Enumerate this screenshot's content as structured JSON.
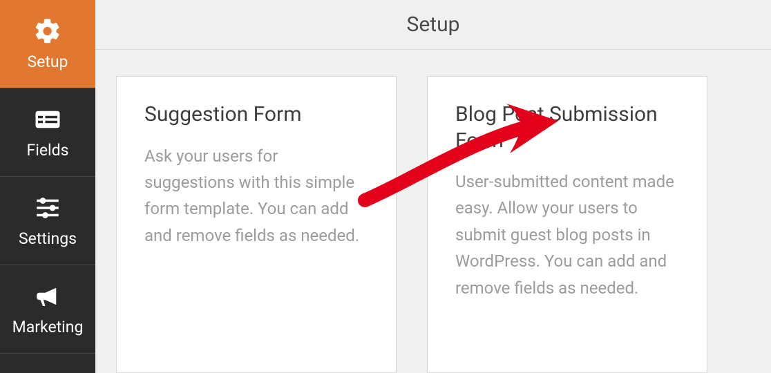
{
  "header": {
    "title": "Setup"
  },
  "sidebar": {
    "items": [
      {
        "label": "Setup",
        "icon": "gear-icon",
        "active": true
      },
      {
        "label": "Fields",
        "icon": "list-icon",
        "active": false
      },
      {
        "label": "Settings",
        "icon": "sliders-icon",
        "active": false
      },
      {
        "label": "Marketing",
        "icon": "megaphone-icon",
        "active": false
      }
    ]
  },
  "cards": [
    {
      "title": "Suggestion Form",
      "description": "Ask your users for suggestions with this simple form template. You can add and remove fields as needed."
    },
    {
      "title": "Blog Post Submission Form",
      "description": "User-submitted content made easy. Allow your users to submit guest blog posts in WordPress. You can add and remove fields as needed."
    }
  ],
  "annotation": {
    "type": "arrow",
    "color": "#e3001b"
  }
}
